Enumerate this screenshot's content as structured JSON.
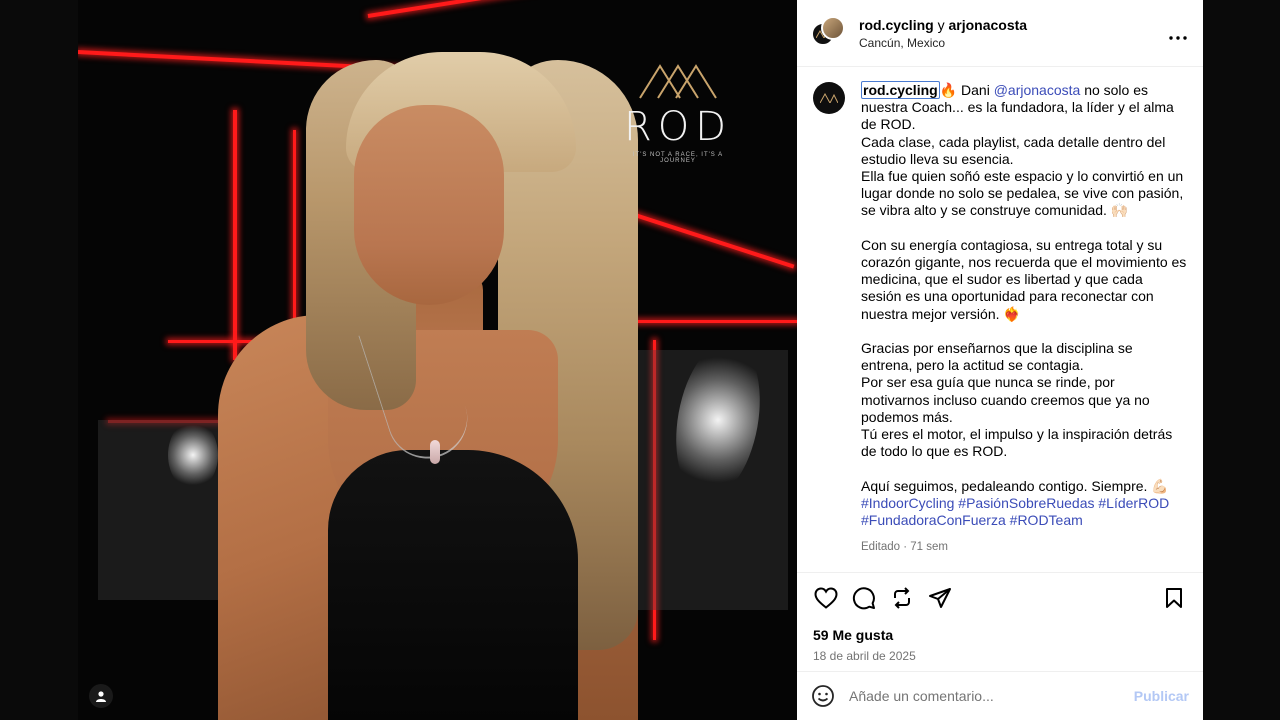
{
  "post": {
    "header": {
      "author": "rod.cycling",
      "conjunction": "y",
      "collaborator": "arjonacosta",
      "location": "Cancún, Mexico",
      "more_icon": "more-horizontal-icon"
    },
    "brand": {
      "logo_word": "ROD",
      "tagline": "IT'S NOT A RACE, IT'S A JOURNEY"
    },
    "caption": {
      "username": "rod.cycling",
      "fire_emoji": "🔥",
      "intro_before_mention": "Dani",
      "mention": "@arjonacosta",
      "intro_after_mention": "no solo es nuestra Coach... es la fundadora, la líder y el alma de ROD.",
      "line2": "Cada clase, cada playlist, cada detalle dentro del estudio lleva su esencia.",
      "line3": "Ella fue quien soñó este espacio y lo convirtió en un lugar donde no solo se pedalea, se vive con pasión, se vibra alto y se construye comunidad. 🙌🏻",
      "para2": "Con su energía contagiosa, su entrega total y su corazón gigante, nos recuerda que el movimiento es medicina, que el sudor es libertad y que cada sesión es una oportunidad para reconectar con nuestra mejor versión. ❤️‍🔥",
      "para3_l1": "Gracias por enseñarnos que la disciplina se entrena, pero la actitud se contagia.",
      "para3_l2": "Por ser esa guía que nunca se rinde, por motivarnos incluso cuando creemos que ya no podemos más.",
      "para3_l3": "Tú eres el motor, el impulso y la inspiración detrás de todo lo que es ROD.",
      "para4": "Aquí seguimos, pedaleando contigo. Siempre. 💪🏻",
      "hashtags": [
        "#IndoorCycling",
        "#PasiónSobreRuedas",
        "#LíderROD",
        "#FundadoraConFuerza",
        "#RODTeam"
      ],
      "meta": "Editado · 71 sem"
    },
    "actions": {
      "likes": "59 Me gusta",
      "date": "18 de abril de 2025"
    },
    "comment": {
      "placeholder": "Añade un comentario...",
      "publish_label": "Publicar"
    }
  },
  "colors": {
    "link": "#3b4cb8",
    "muted": "#737373",
    "publish_disabled": "#b3c8f5",
    "neon": "#ff1a1a"
  }
}
